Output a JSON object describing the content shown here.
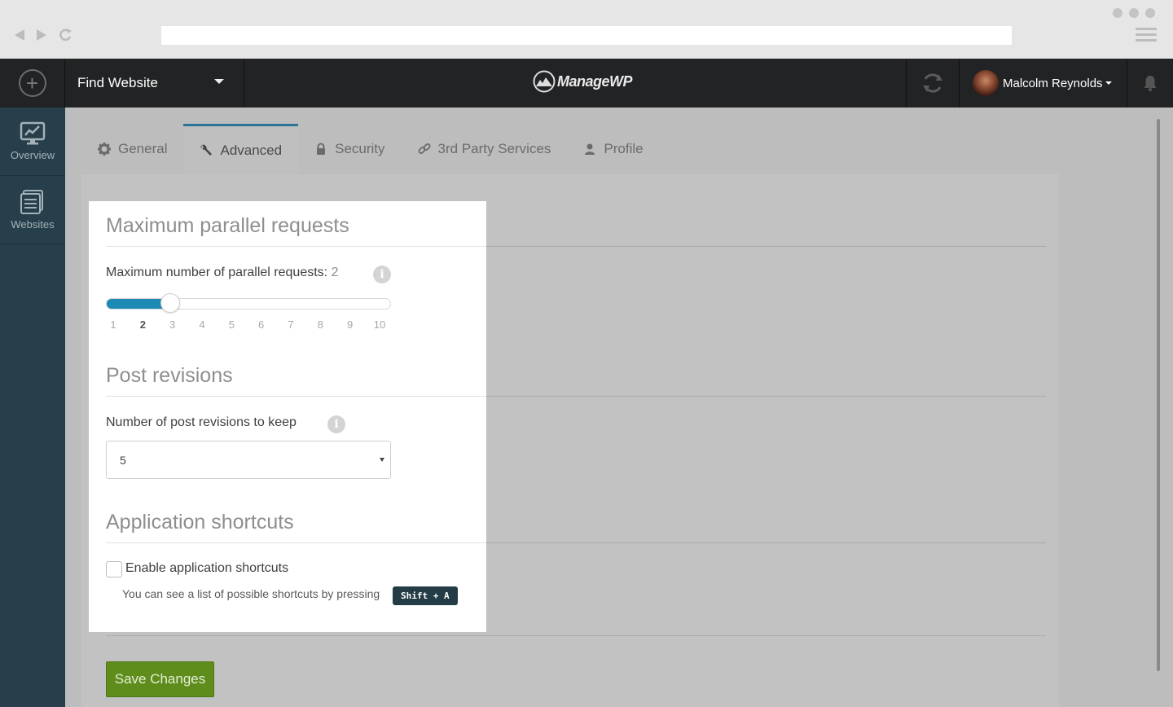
{
  "header": {
    "find_website_label": "Find Website",
    "logo_text": "ManageWP",
    "user_name": "Malcolm Reynolds"
  },
  "sidebar": {
    "items": [
      {
        "label": "Overview",
        "icon": "chart-monitor-icon"
      },
      {
        "label": "Websites",
        "icon": "websites-list-icon"
      }
    ]
  },
  "tabs": [
    {
      "label": "General",
      "icon": "gear-icon"
    },
    {
      "label": "Advanced",
      "icon": "wrench-icon",
      "active": true
    },
    {
      "label": "Security",
      "icon": "lock-icon"
    },
    {
      "label": "3rd Party Services",
      "icon": "link-icon"
    },
    {
      "label": "Profile",
      "icon": "user-icon"
    }
  ],
  "parallel": {
    "title": "Maximum parallel requests",
    "label": "Maximum number of parallel requests:",
    "value": "2",
    "ticks": [
      "1",
      "2",
      "3",
      "4",
      "5",
      "6",
      "7",
      "8",
      "9",
      "10"
    ],
    "min": 1,
    "max": 10
  },
  "revisions": {
    "title": "Post revisions",
    "label": "Number of post revisions to keep",
    "selected": "5"
  },
  "shortcuts": {
    "title": "Application shortcuts",
    "checkbox_label": "Enable application shortcuts",
    "checked": false,
    "help_text": "You can see a list of possible shortcuts by pressing",
    "key_combo": "Shift + A"
  },
  "actions": {
    "save_label": "Save Changes"
  },
  "colors": {
    "accent": "#1c8ab3",
    "save_button": "#5e8d1c",
    "sidebar": "#263f4a",
    "header": "#222325"
  }
}
